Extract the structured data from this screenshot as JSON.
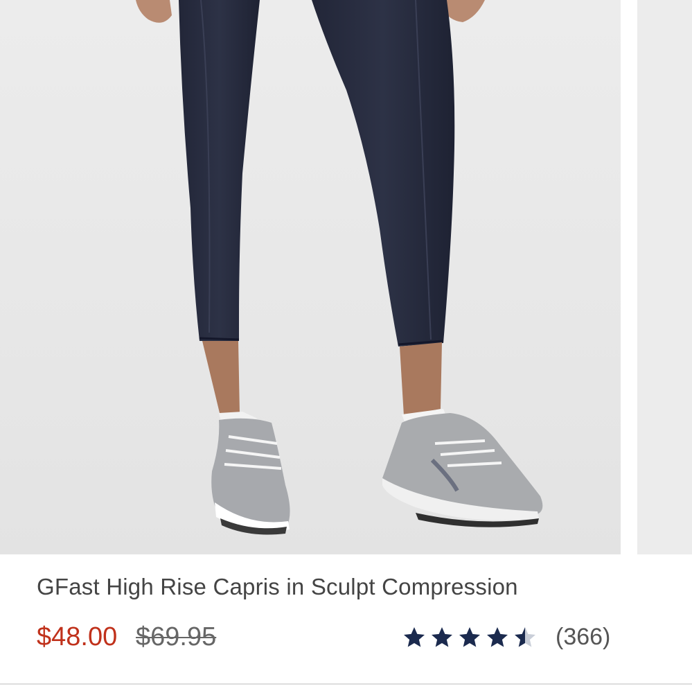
{
  "product": {
    "name": "GFast High Rise Capris in Sculpt Compression",
    "sale_price": "$48.00",
    "original_price": "$69.95",
    "rating": 4.5,
    "max_rating": 5,
    "review_count": "(366)",
    "image_icon": "product-photo"
  },
  "colors": {
    "sale_price": "#c0311b",
    "star": "#1b2a4e",
    "star_empty": "#c9ced8",
    "name_text": "#444444"
  }
}
